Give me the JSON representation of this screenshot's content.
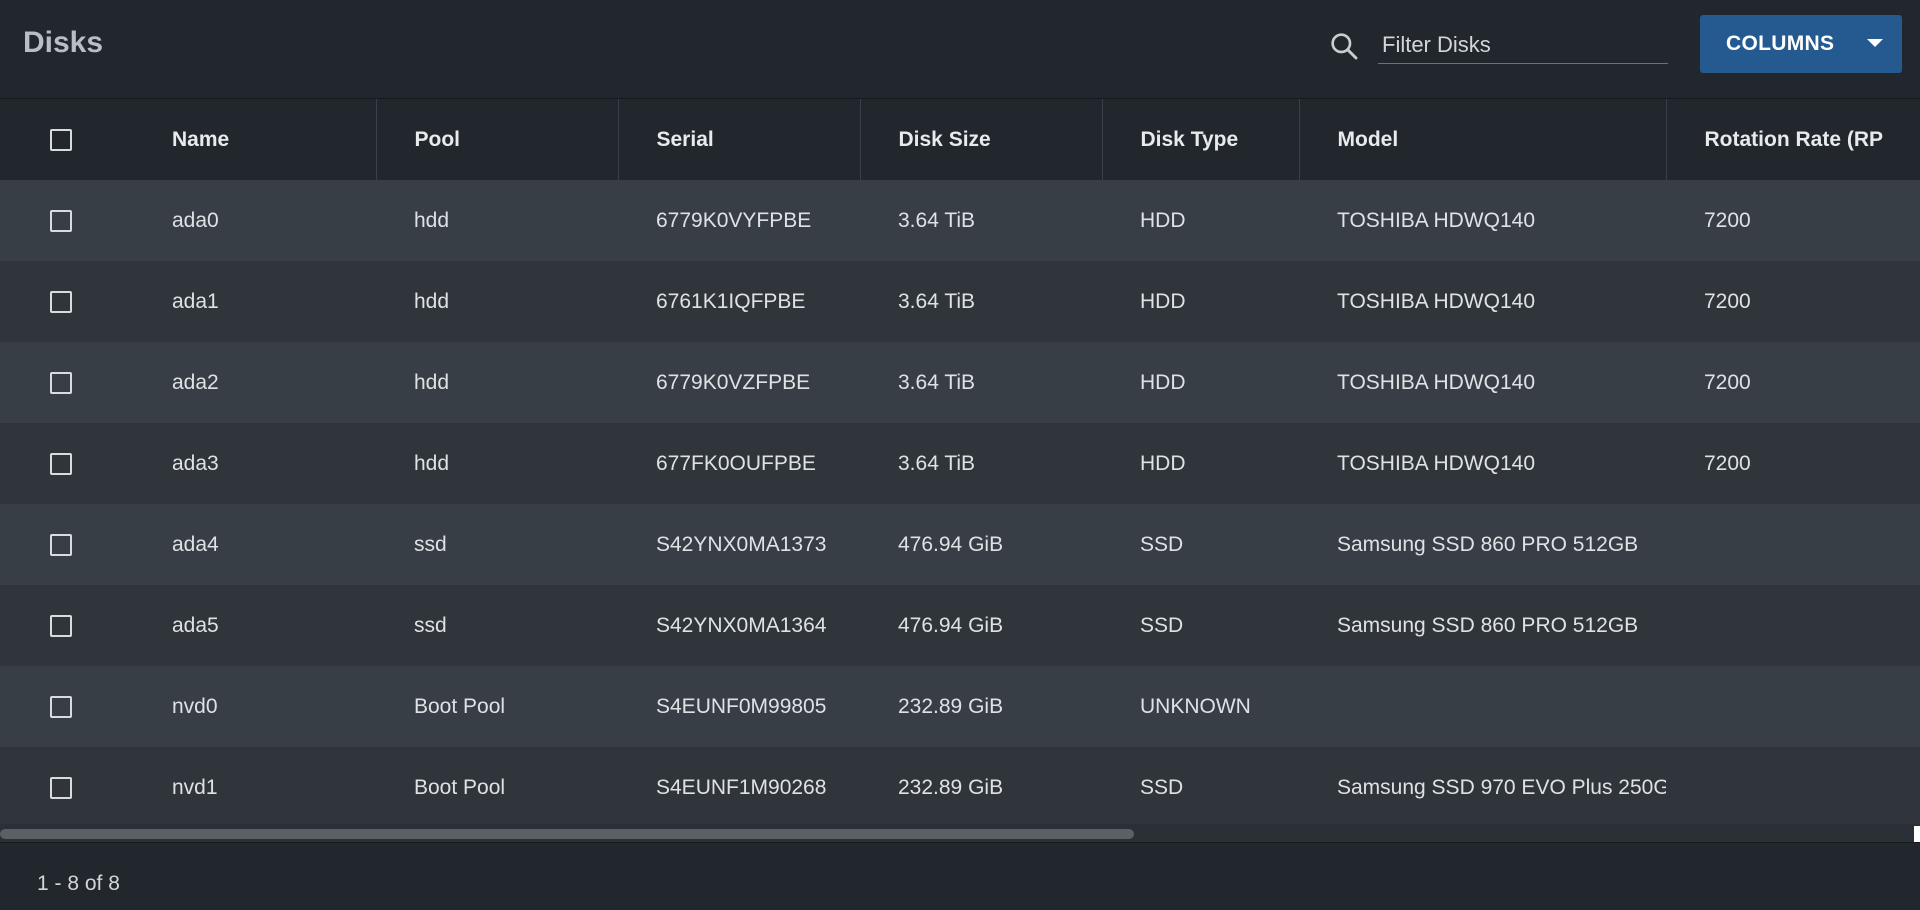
{
  "header": {
    "title": "Disks",
    "search": {
      "placeholder": "Filter Disks",
      "value": ""
    },
    "columns_button": {
      "label": "COLUMNS"
    }
  },
  "table": {
    "columns": [
      "Name",
      "Pool",
      "Serial",
      "Disk Size",
      "Disk Type",
      "Model",
      "Rotation Rate (RP"
    ],
    "rows": [
      {
        "name": "ada0",
        "pool": "hdd",
        "serial": "6779K0VYFPBE",
        "size": "3.64 TiB",
        "type": "HDD",
        "model": "TOSHIBA HDWQ140",
        "rpm": "7200"
      },
      {
        "name": "ada1",
        "pool": "hdd",
        "serial": "6761K1IQFPBE",
        "size": "3.64 TiB",
        "type": "HDD",
        "model": "TOSHIBA HDWQ140",
        "rpm": "7200"
      },
      {
        "name": "ada2",
        "pool": "hdd",
        "serial": "6779K0VZFPBE",
        "size": "3.64 TiB",
        "type": "HDD",
        "model": "TOSHIBA HDWQ140",
        "rpm": "7200"
      },
      {
        "name": "ada3",
        "pool": "hdd",
        "serial": "677FK0OUFPBE",
        "size": "3.64 TiB",
        "type": "HDD",
        "model": "TOSHIBA HDWQ140",
        "rpm": "7200"
      },
      {
        "name": "ada4",
        "pool": "ssd",
        "serial": "S42YNX0MA1373",
        "size": "476.94 GiB",
        "type": "SSD",
        "model": "Samsung SSD 860 PRO 512GB",
        "rpm": ""
      },
      {
        "name": "ada5",
        "pool": "ssd",
        "serial": "S42YNX0MA1364",
        "size": "476.94 GiB",
        "type": "SSD",
        "model": "Samsung SSD 860 PRO 512GB",
        "rpm": ""
      },
      {
        "name": "nvd0",
        "pool": "Boot Pool",
        "serial": "S4EUNF0M99805",
        "size": "232.89 GiB",
        "type": "UNKNOWN",
        "model": "",
        "rpm": ""
      },
      {
        "name": "nvd1",
        "pool": "Boot Pool",
        "serial": "S4EUNF1M90268",
        "size": "232.89 GiB",
        "type": "SSD",
        "model": "Samsung SSD 970 EVO Plus 250G",
        "rpm": ""
      }
    ]
  },
  "footer": {
    "range_text": "1 - 8 of 8"
  }
}
